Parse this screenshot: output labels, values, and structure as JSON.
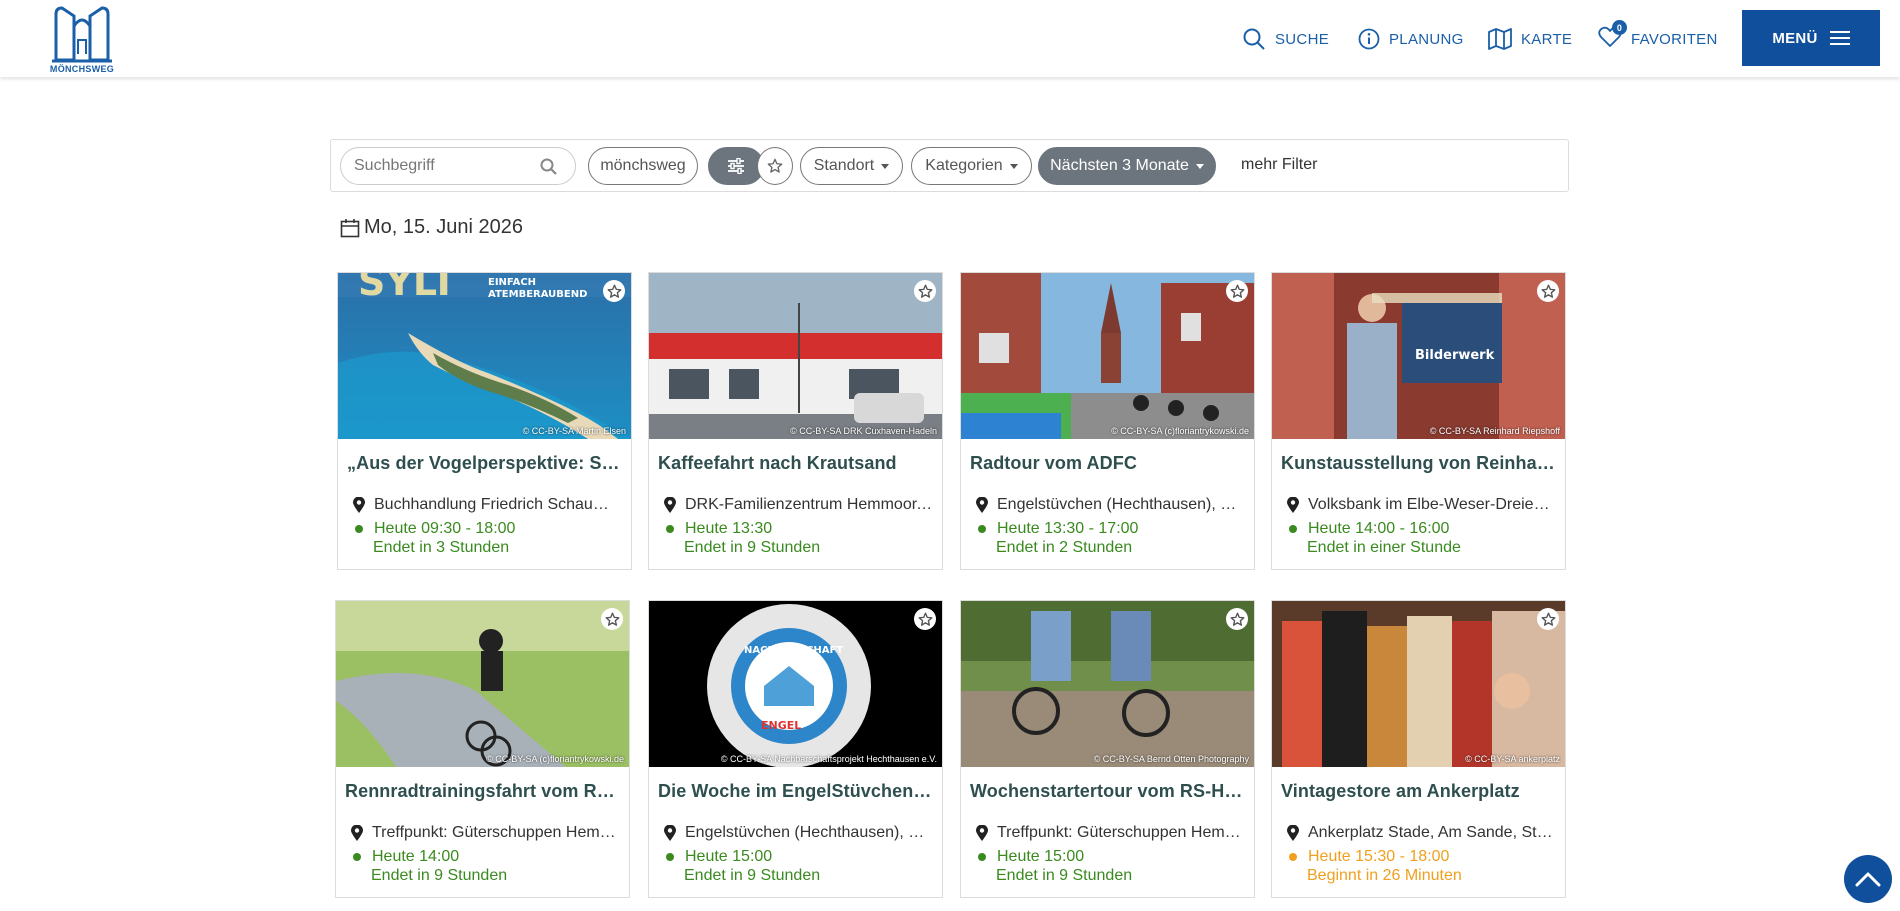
{
  "header": {
    "logo_text": "MÖNCHSWEG",
    "nav": [
      {
        "label": "SUCHE",
        "icon": "search-icon"
      },
      {
        "label": "PLANUNG",
        "icon": "info-icon"
      },
      {
        "label": "KARTE",
        "icon": "map-icon"
      },
      {
        "label": "FAVORITEN",
        "icon": "heart-icon",
        "badge": "0"
      }
    ],
    "menu_label": "MENÜ",
    "accent_color": "#1a5fa8"
  },
  "filters": {
    "search_placeholder": "Suchbegriff",
    "tag_label": "mönchsweg",
    "standort_label": "Standort",
    "kategorien_label": "Kategorien",
    "period_label": "Nächsten 3 Monate",
    "more_filter_label": "mehr Filter"
  },
  "date_heading": "Mo, 15. Juni 2026",
  "events": [
    {
      "title": "„Aus der Vogelperspektive: Sylt u…",
      "location": "Buchhandlung Friedrich Schaumb…",
      "time": "Heute 09:30 - 18:00",
      "status": "Endet in 3 Stunden",
      "status_color": "#3a8a1f",
      "credit": "© CC-BY-SA Martin Elsen",
      "image": "sylt-aerial"
    },
    {
      "title": "Kaffeefahrt nach Krautsand",
      "location": "DRK-Familienzentrum Hemmoor, …",
      "time": "Heute 13:30",
      "status": "Endet in 9 Stunden",
      "status_color": "#3a8a1f",
      "credit": "© CC-BY-SA DRK Cuxhaven-Hadeln",
      "image": "drk-building"
    },
    {
      "title": "Radtour vom ADFC",
      "location": "Engelstüvchen (Hechthausen), M…",
      "time": "Heute 13:30 - 17:00",
      "status": "Endet in 2 Stunden",
      "status_color": "#3a8a1f",
      "credit": "© CC-BY-SA (c)floriantrykowski.de",
      "image": "cyclists-street"
    },
    {
      "title": "Kunstausstellung von Reinhard R…",
      "location": "Volksbank im Elbe-Weser-Dreiec…",
      "time": "Heute 14:00 - 16:00",
      "status": "Endet in einer Stunde",
      "status_color": "#3a8a1f",
      "credit": "© CC-BY-SA Reinhard Riepshoff",
      "image": "bilderwerk-sign"
    },
    {
      "title": "Rennradtrainingsfahrt vom RS-H…",
      "location": "Treffpunkt: Güterschuppen Hem…",
      "time": "Heute 14:00",
      "status": "Endet in 9 Stunden",
      "status_color": "#3a8a1f",
      "credit": "© CC-BY-SA (c)floriantrykowski.de",
      "image": "road-cyclist"
    },
    {
      "title": "Die Woche im EngelStüvchen - St…",
      "location": "Engelstüvchen (Hechthausen), M…",
      "time": "Heute 15:00",
      "status": "Endet in 9 Stunden",
      "status_color": "#3a8a1f",
      "credit": "© CC-BY-SA Nachbarschaftsprojekt Hechthausen e.V.",
      "image": "nachbarschaft-logo"
    },
    {
      "title": "Wochenstartertour vom RS-Hem…",
      "location": "Treffpunkt: Güterschuppen Hem…",
      "time": "Heute 15:00",
      "status": "Endet in 9 Stunden",
      "status_color": "#3a8a1f",
      "credit": "© CC-BY-SA Bernd Otten Photography",
      "image": "bike-riders"
    },
    {
      "title": "Vintagestore am Ankerplatz",
      "location": "Ankerplatz Stade, Am Sande, Stade",
      "time": "Heute 15:30 - 18:00",
      "status": "Beginnt in 26 Minuten",
      "status_color": "#f0a01e",
      "credit": "© CC-BY-SA ankerplatz",
      "image": "clothes-rack"
    }
  ]
}
